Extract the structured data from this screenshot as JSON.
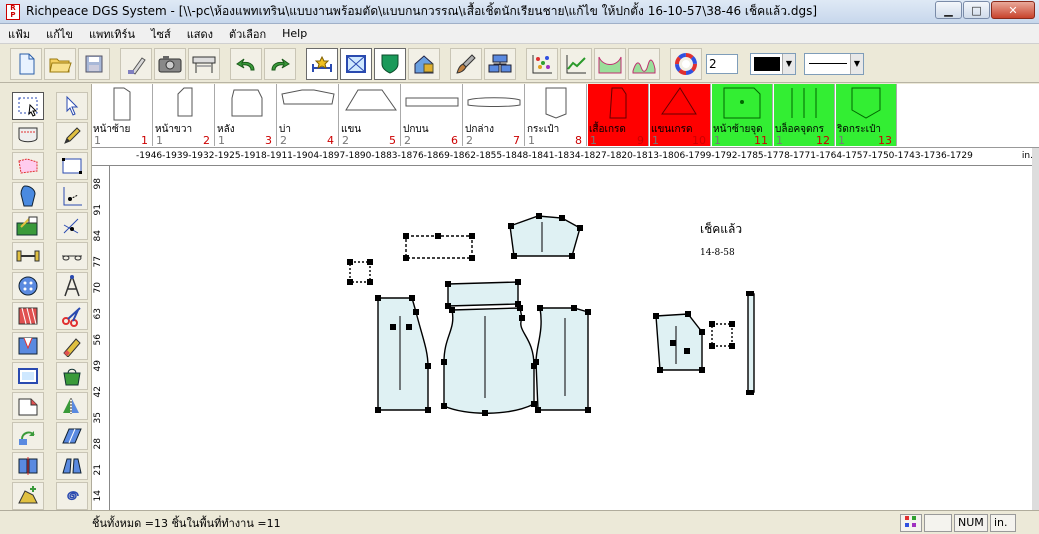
{
  "window": {
    "title": "Richpeace DGS System - [\\\\-pc\\ห้องแพทเทริน\\แบบงานพร้อมตัด\\แบบกนกวรรณ\\เสื้อเชิ้ตนักเรียนชาย\\แก้ไข ให้ปกตั้ง 16-10-57\\38-46 เช็คแล้ว.dgs]",
    "icon_text": "R P",
    "minimize": "▁",
    "maximize": "□",
    "close": "✕"
  },
  "menu": [
    "แฟ้ม",
    "แก้ไข",
    "แพทเทิร์น",
    "ไซส์",
    "แสดง",
    "ตัวเลือก",
    "Help"
  ],
  "toolbar": {
    "line_width_value": "2",
    "color_arrow": "▼",
    "line_arrow": "▼"
  },
  "pieces": [
    {
      "name": "หน้าซ้าย",
      "qty": "1",
      "num": "1",
      "state": "normal"
    },
    {
      "name": "หน้าขวา",
      "qty": "1",
      "num": "2",
      "state": "normal"
    },
    {
      "name": "หลัง",
      "qty": "1",
      "num": "3",
      "state": "normal"
    },
    {
      "name": "บ่า",
      "qty": "2",
      "num": "4",
      "state": "normal"
    },
    {
      "name": "แขน",
      "qty": "2",
      "num": "5",
      "state": "normal"
    },
    {
      "name": "ปกบน",
      "qty": "2",
      "num": "6",
      "state": "normal"
    },
    {
      "name": "ปกล่าง",
      "qty": "2",
      "num": "7",
      "state": "normal"
    },
    {
      "name": "กระเป๋า",
      "qty": "1",
      "num": "8",
      "state": "normal"
    },
    {
      "name": "เสื้อเกรด",
      "qty": "1",
      "num": "9",
      "state": "red"
    },
    {
      "name": "แขนเกรด",
      "qty": "1",
      "num": "10",
      "state": "red"
    },
    {
      "name": "หน้าซ้ายจุด",
      "qty": "1",
      "num": "11",
      "state": "green"
    },
    {
      "name": "บล็อคจุดกร",
      "qty": "1",
      "num": "12",
      "state": "green"
    },
    {
      "name": "ริดกระเป๋า",
      "qty": "1",
      "num": "13",
      "state": "green"
    }
  ],
  "ruler": {
    "h_ticks": "-1946-1939-1932-1925-1918-1911-1904-1897-1890-1883-1876-1869-1862-1855-1848-1841-1834-1827-1820-1813-1806-1799-1792-1785-1778-1771-1764-1757-1750-1743-1736-1729",
    "unit": "in.",
    "v_ticks": [
      "98",
      "91",
      "84",
      "77",
      "70",
      "63",
      "56",
      "49",
      "42",
      "35",
      "28",
      "21",
      "14"
    ]
  },
  "canvas": {
    "note_checked": "เช็คแล้ว",
    "note_date": "14-8-58"
  },
  "status": {
    "summary": "ชิ้นทั้งหมด =13   ชิ้นในพื้นที่ทำงาน =11",
    "num": "NUM",
    "unit": "in."
  },
  "colors": {
    "piece_fill": "#dff1f3",
    "piece_red": "#ff0000",
    "piece_green": "#33ee33",
    "point_marker": "#000000"
  }
}
